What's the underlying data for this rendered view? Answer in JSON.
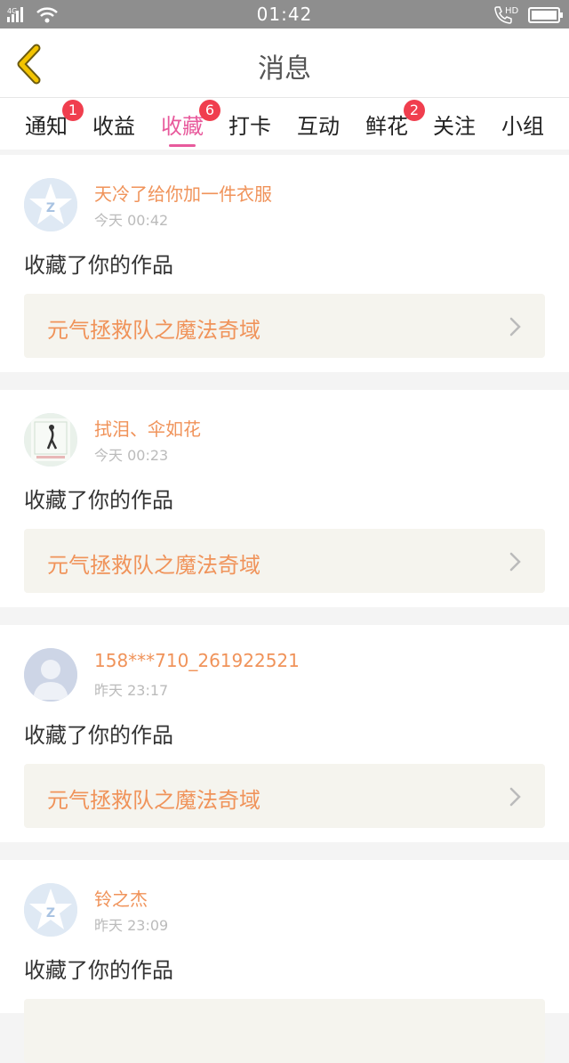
{
  "status_bar": {
    "network": "4G",
    "time": "01:42",
    "call_label": "HD"
  },
  "header": {
    "title": "消息"
  },
  "tabs": [
    {
      "label": "通知",
      "badge": "1",
      "active": false
    },
    {
      "label": "收益",
      "badge": "",
      "active": false
    },
    {
      "label": "收藏",
      "badge": "6",
      "active": true
    },
    {
      "label": "打卡",
      "badge": "",
      "active": false
    },
    {
      "label": "互动",
      "badge": "",
      "active": false
    },
    {
      "label": "鲜花",
      "badge": "2",
      "active": false
    },
    {
      "label": "关注",
      "badge": "",
      "active": false
    },
    {
      "label": "小组",
      "badge": "",
      "active": false
    }
  ],
  "messages": [
    {
      "name": "天冷了给你加一件衣服",
      "time": "今天 00:42",
      "action": "收藏了你的作品",
      "work_title": "元气拯救队之魔法奇域",
      "avatar": "default-star-avatar"
    },
    {
      "name": "拭泪、伞如花",
      "time": "今天 00:23",
      "action": "收藏了你的作品",
      "work_title": "元气拯救队之魔法奇域",
      "avatar": "photo-avatar"
    },
    {
      "name": "158***710_261922521",
      "time": "昨天 23:17",
      "action": "收藏了你的作品",
      "work_title": "元气拯救队之魔法奇域",
      "avatar": "default-person-avatar"
    },
    {
      "name": "铃之杰",
      "time": "昨天 23:09",
      "action": "收藏了你的作品",
      "work_title": "",
      "avatar": "default-star-avatar"
    }
  ],
  "colors": {
    "accent_pink": "#e85a9c",
    "name_orange": "#f0935a",
    "badge_red": "#f03e4e",
    "back_yellow": "#f3c400"
  }
}
